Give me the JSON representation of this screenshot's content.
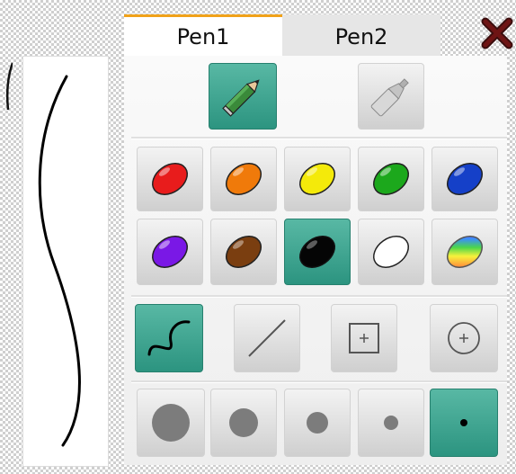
{
  "tabs": [
    {
      "label": "Pen1",
      "active": true
    },
    {
      "label": "Pen2",
      "active": false
    }
  ],
  "close_icon": "close-x-icon",
  "tools": [
    {
      "name": "pencil",
      "icon": "pencil-icon",
      "selected": true
    },
    {
      "name": "marker",
      "icon": "highlighter-icon",
      "selected": false
    }
  ],
  "colors": [
    {
      "name": "red",
      "hex": "#e81c1c"
    },
    {
      "name": "orange",
      "hex": "#f07a0a"
    },
    {
      "name": "yellow",
      "hex": "#f4ea0a"
    },
    {
      "name": "green",
      "hex": "#1ca81c"
    },
    {
      "name": "blue",
      "hex": "#1540c8"
    },
    {
      "name": "purple",
      "hex": "#7a18e6"
    },
    {
      "name": "brown",
      "hex": "#7a3e10"
    },
    {
      "name": "black",
      "hex": "#050505",
      "selected": true
    },
    {
      "name": "white",
      "hex": "#ffffff"
    },
    {
      "name": "rainbow",
      "hex": "rainbow"
    }
  ],
  "shapes": [
    {
      "name": "freehand",
      "icon": "freehand-curve-icon",
      "selected": true
    },
    {
      "name": "line",
      "icon": "line-icon",
      "selected": false
    },
    {
      "name": "rectangle",
      "icon": "rectangle-icon",
      "selected": false
    },
    {
      "name": "circle",
      "icon": "circle-icon",
      "selected": false
    }
  ],
  "sizes": [
    {
      "name": "size-1",
      "selected": false
    },
    {
      "name": "size-2",
      "selected": false
    },
    {
      "name": "size-3",
      "selected": false
    },
    {
      "name": "size-4",
      "selected": false
    },
    {
      "name": "size-5",
      "selected": true
    }
  ],
  "accent": "#2f9a85"
}
